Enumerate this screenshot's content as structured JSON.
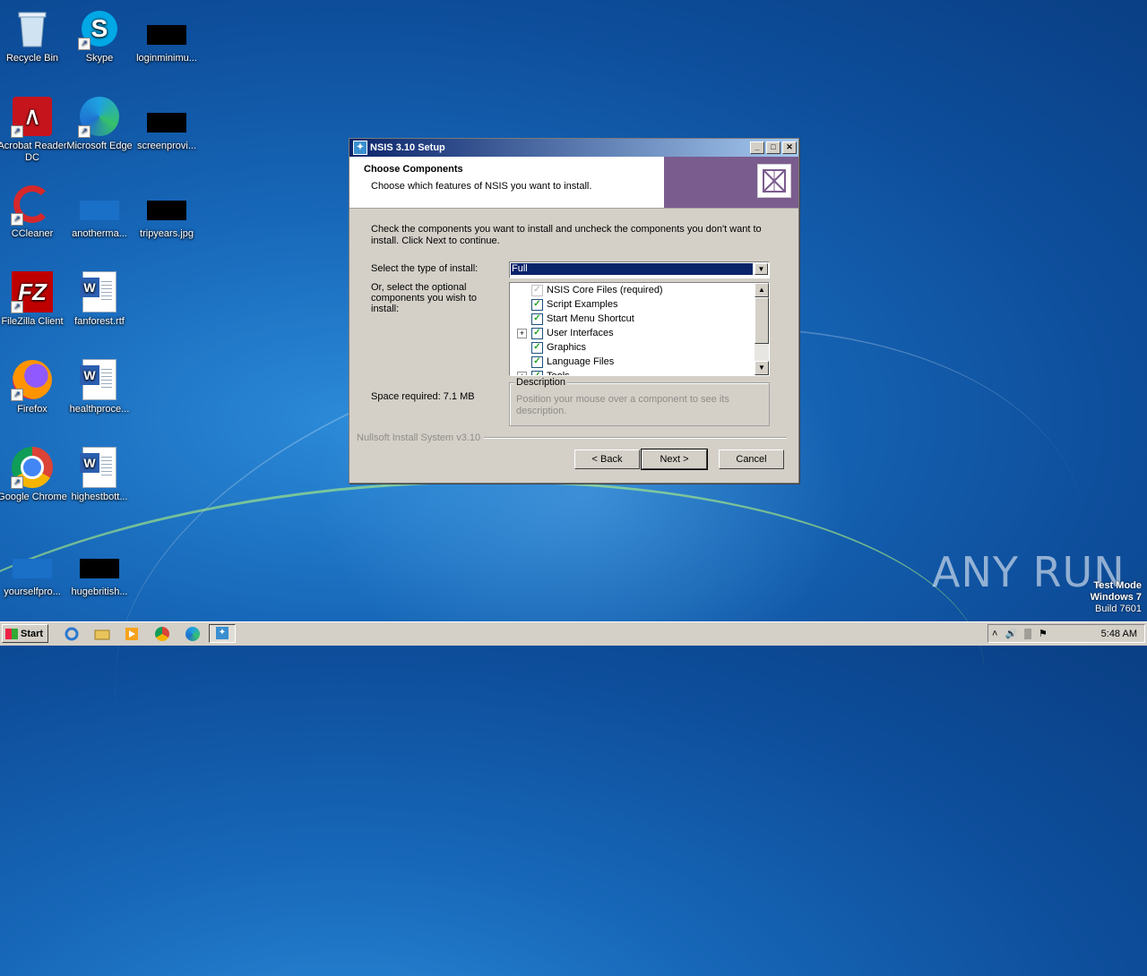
{
  "desktop": {
    "icons": [
      {
        "label": "Recycle Bin"
      },
      {
        "label": "Skype"
      },
      {
        "label": "loginminimu..."
      },
      {
        "label": "Acrobat Reader DC"
      },
      {
        "label": "Microsoft Edge"
      },
      {
        "label": "screenprovi..."
      },
      {
        "label": "CCleaner"
      },
      {
        "label": "anotherma..."
      },
      {
        "label": "tripyears.jpg"
      },
      {
        "label": "FileZilla Client"
      },
      {
        "label": "fanforest.rtf"
      },
      {
        "label": "Firefox"
      },
      {
        "label": "healthproce..."
      },
      {
        "label": "Google Chrome"
      },
      {
        "label": "highestbott..."
      },
      {
        "label": "yourselfpro..."
      },
      {
        "label": "hugebritish..."
      }
    ],
    "watermark": "ANY RUN",
    "test_mode": {
      "line1": "Test Mode",
      "line2": "Windows 7",
      "line3": "Build 7601"
    }
  },
  "window": {
    "title": "NSIS 3.10 Setup",
    "header_title": "Choose Components",
    "header_subtitle": "Choose which features of NSIS you want to install.",
    "instructions": "Check the components you want to install and uncheck the components you don't want to install. Click Next to continue.",
    "install_type_label": "Select the type of install:",
    "install_type_value": "Full",
    "optional_label": "Or, select the optional components you wish to install:",
    "components": [
      {
        "label": "NSIS Core Files (required)",
        "checked": true,
        "disabled": true
      },
      {
        "label": "Script Examples",
        "checked": true
      },
      {
        "label": "Start Menu Shortcut",
        "checked": true
      },
      {
        "label": "User Interfaces",
        "checked": true,
        "expandable": true
      },
      {
        "label": "Graphics",
        "checked": true
      },
      {
        "label": "Language Files",
        "checked": true
      },
      {
        "label": "Tools",
        "checked": true,
        "expandable": true
      }
    ],
    "space_required": "Space required: 7.1 MB",
    "description_legend": "Description",
    "description_text": "Position your mouse over a component to see its description.",
    "branding": "Nullsoft Install System v3.10",
    "buttons": {
      "back": "< Back",
      "next": "Next >",
      "cancel": "Cancel"
    }
  },
  "taskbar": {
    "start": "Start",
    "clock": "5:48 AM"
  }
}
